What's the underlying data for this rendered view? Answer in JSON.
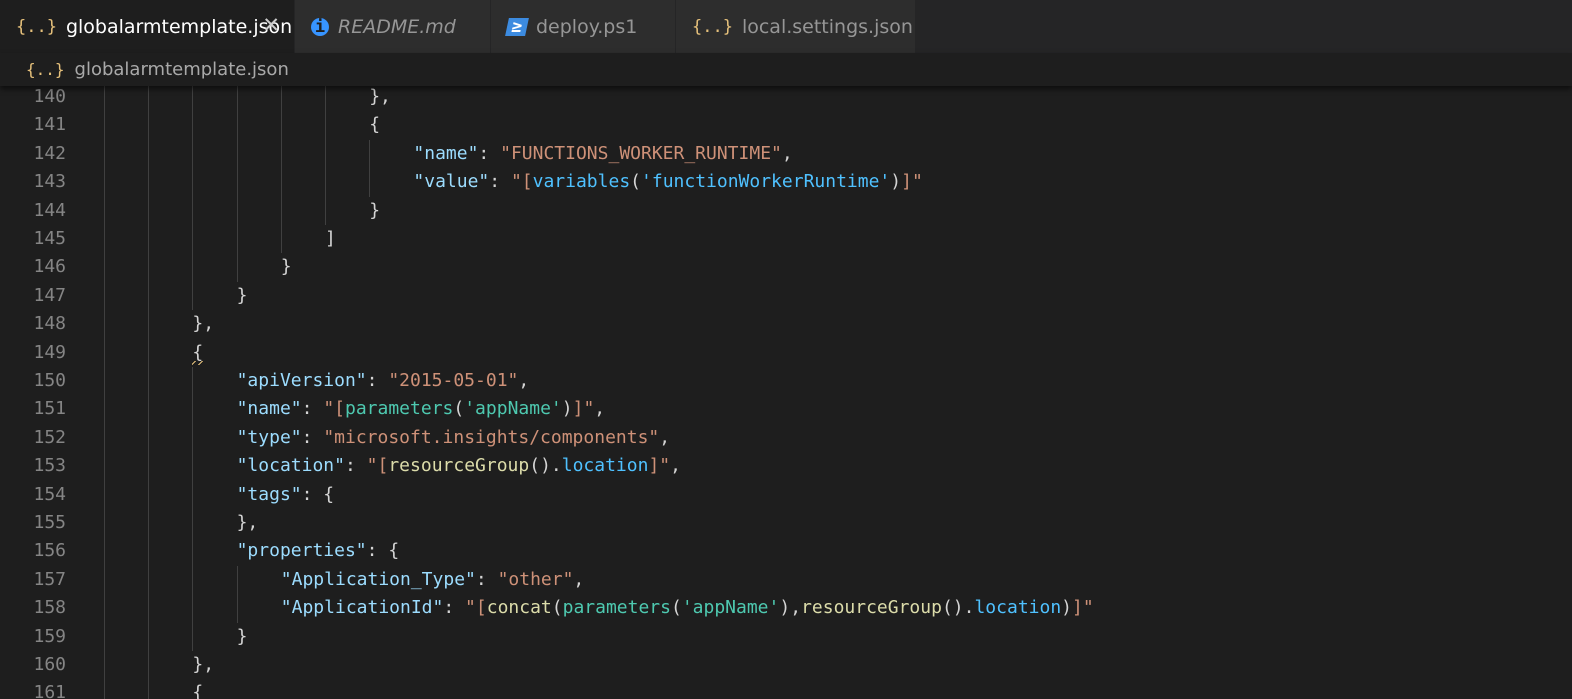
{
  "tabs": [
    {
      "label": "globalarmtemplate.json",
      "icon": "json-icon",
      "icon_glyph": "{..}",
      "active": true,
      "italic": false,
      "closable": true,
      "close_glyph": "✕"
    },
    {
      "label": "README.md",
      "icon": "info-icon",
      "icon_glyph": "i",
      "active": false,
      "italic": true,
      "closable": false
    },
    {
      "label": "deploy.ps1",
      "icon": "powershell-icon",
      "icon_glyph": "≥",
      "active": false,
      "italic": false,
      "closable": false
    },
    {
      "label": "local.settings.json",
      "icon": "json-icon",
      "icon_glyph": "{..}",
      "active": false,
      "italic": false,
      "closable": false
    }
  ],
  "breadcrumb": {
    "icon": "json-icon",
    "icon_glyph": "{..}",
    "label": "globalarmtemplate.json"
  },
  "colors": {
    "editor_bg": "#1e1e1e",
    "key": "#9cdcfe",
    "string": "#ce9178",
    "function": "#4ec9b0",
    "member": "#4fc1ff",
    "line_number": "#858585"
  },
  "code": [
    {
      "n": "140",
      "indent": 6,
      "tokens": [
        [
          "pun",
          "},"
        ]
      ]
    },
    {
      "n": "141",
      "indent": 6,
      "tokens": [
        [
          "pun",
          "{"
        ]
      ]
    },
    {
      "n": "142",
      "indent": 7,
      "tokens": [
        [
          "key",
          "\"name\""
        ],
        [
          "pun",
          ": "
        ],
        [
          "str",
          "\"FUNCTIONS_WORKER_RUNTIME\""
        ],
        [
          "pun",
          ","
        ]
      ]
    },
    {
      "n": "143",
      "indent": 7,
      "tokens": [
        [
          "key",
          "\"value\""
        ],
        [
          "pun",
          ": "
        ],
        [
          "str",
          "\"["
        ],
        [
          "arg",
          "variables"
        ],
        [
          "pun",
          "("
        ],
        [
          "arg",
          "'functionWorkerRuntime'"
        ],
        [
          "pun",
          ")"
        ],
        [
          "str",
          "]\""
        ]
      ]
    },
    {
      "n": "144",
      "indent": 6,
      "tokens": [
        [
          "pun",
          "}"
        ]
      ]
    },
    {
      "n": "145",
      "indent": 5,
      "tokens": [
        [
          "pun",
          "]"
        ]
      ]
    },
    {
      "n": "146",
      "indent": 4,
      "tokens": [
        [
          "pun",
          "}"
        ]
      ]
    },
    {
      "n": "147",
      "indent": 3,
      "tokens": [
        [
          "pun",
          "}"
        ]
      ]
    },
    {
      "n": "148",
      "indent": 2,
      "tokens": [
        [
          "pun",
          "},"
        ]
      ]
    },
    {
      "n": "149",
      "indent": 2,
      "tokens": [
        [
          "sq",
          "{"
        ]
      ]
    },
    {
      "n": "150",
      "indent": 3,
      "tokens": [
        [
          "key",
          "\"apiVersion\""
        ],
        [
          "pun",
          ": "
        ],
        [
          "str",
          "\"2015-05-01\""
        ],
        [
          "pun",
          ","
        ]
      ]
    },
    {
      "n": "151",
      "indent": 3,
      "tokens": [
        [
          "key",
          "\"name\""
        ],
        [
          "pun",
          ": "
        ],
        [
          "str",
          "\"["
        ],
        [
          "fn",
          "parameters"
        ],
        [
          "pun",
          "("
        ],
        [
          "fn",
          "'appName'"
        ],
        [
          "pun",
          ")"
        ],
        [
          "str",
          "]\""
        ],
        [
          "pun",
          ","
        ]
      ]
    },
    {
      "n": "152",
      "indent": 3,
      "tokens": [
        [
          "key",
          "\"type\""
        ],
        [
          "pun",
          ": "
        ],
        [
          "str",
          "\"microsoft.insights/components\""
        ],
        [
          "pun",
          ","
        ]
      ]
    },
    {
      "n": "153",
      "indent": 3,
      "tokens": [
        [
          "key",
          "\"location\""
        ],
        [
          "pun",
          ": "
        ],
        [
          "str",
          "\"["
        ],
        [
          "fnc",
          "resourceGroup"
        ],
        [
          "pun",
          "()."
        ],
        [
          "mem",
          "location"
        ],
        [
          "str",
          "]\""
        ],
        [
          "pun",
          ","
        ]
      ]
    },
    {
      "n": "154",
      "indent": 3,
      "tokens": [
        [
          "key",
          "\"tags\""
        ],
        [
          "pun",
          ": {"
        ]
      ]
    },
    {
      "n": "155",
      "indent": 3,
      "tokens": [
        [
          "pun",
          "},"
        ]
      ]
    },
    {
      "n": "156",
      "indent": 3,
      "tokens": [
        [
          "key",
          "\"properties\""
        ],
        [
          "pun",
          ": {"
        ]
      ]
    },
    {
      "n": "157",
      "indent": 4,
      "tokens": [
        [
          "key",
          "\"Application_Type\""
        ],
        [
          "pun",
          ": "
        ],
        [
          "str",
          "\"other\""
        ],
        [
          "pun",
          ","
        ]
      ]
    },
    {
      "n": "158",
      "indent": 4,
      "tokens": [
        [
          "key",
          "\"ApplicationId\""
        ],
        [
          "pun",
          ": "
        ],
        [
          "str",
          "\"["
        ],
        [
          "fnc",
          "concat"
        ],
        [
          "pun",
          "("
        ],
        [
          "fn",
          "parameters"
        ],
        [
          "pun",
          "("
        ],
        [
          "fn",
          "'appName'"
        ],
        [
          "pun",
          "),"
        ],
        [
          "fnc",
          "resourceGroup"
        ],
        [
          "pun",
          "()."
        ],
        [
          "mem",
          "location"
        ],
        [
          "pun",
          ")"
        ],
        [
          "str",
          "]\""
        ]
      ]
    },
    {
      "n": "159",
      "indent": 3,
      "tokens": [
        [
          "pun",
          "}"
        ]
      ]
    },
    {
      "n": "160",
      "indent": 2,
      "tokens": [
        [
          "pun",
          "},"
        ]
      ]
    },
    {
      "n": "161",
      "indent": 2,
      "tokens": [
        [
          "pun",
          "{"
        ]
      ]
    }
  ]
}
